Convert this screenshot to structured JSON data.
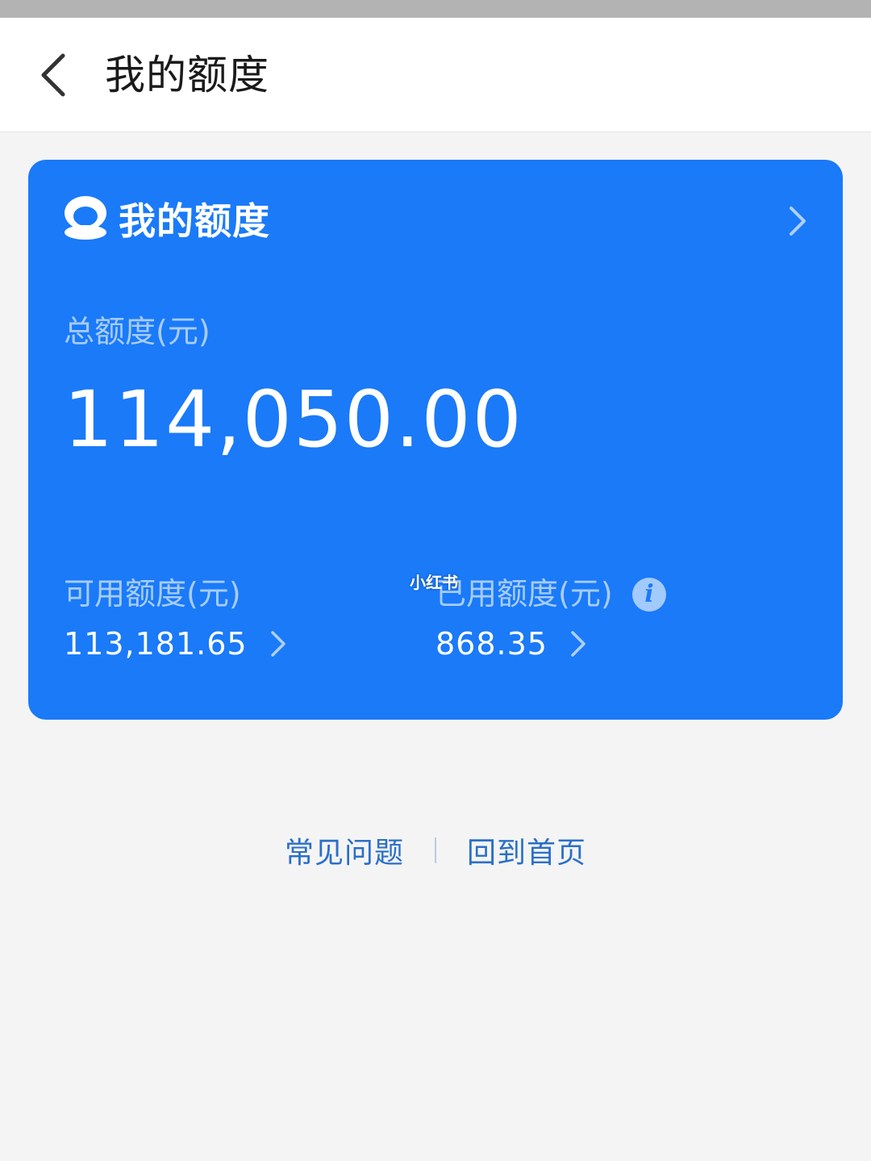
{
  "nav": {
    "title": "我的额度"
  },
  "card": {
    "title": "我的额度",
    "logo_icon": "coin-logo-icon",
    "total": {
      "label": "总额度(元)",
      "value": "114,050.00"
    },
    "available": {
      "label": "可用额度(元)",
      "value": "113,181.65"
    },
    "used": {
      "label": "已用额度(元)",
      "value": "868.35",
      "info_icon_glyph": "i"
    }
  },
  "watermark": "小红书",
  "footer": {
    "faq_label": "常见问题",
    "home_label": "回到首页"
  },
  "colors": {
    "card_blue": "#1a7af8",
    "link_blue": "#2a6fc9",
    "page_bg": "#f4f4f4"
  }
}
